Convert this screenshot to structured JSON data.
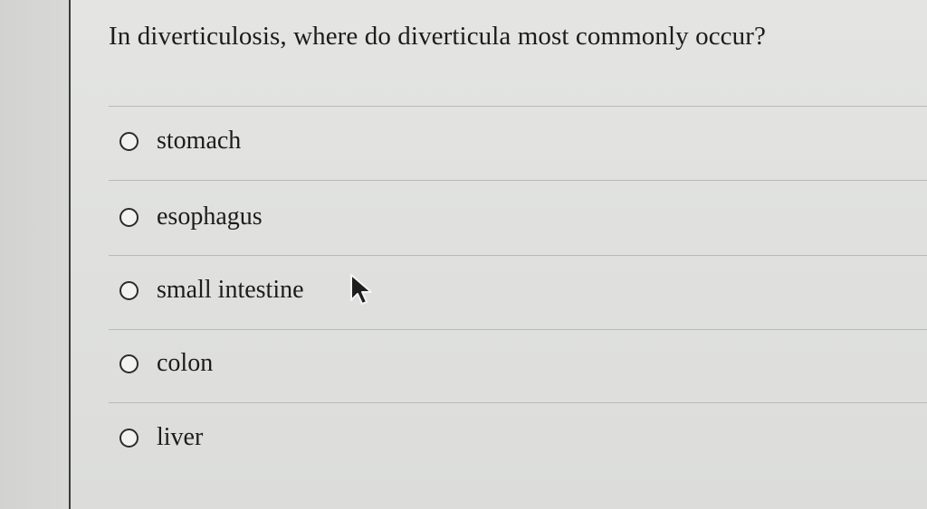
{
  "question": {
    "text": "In diverticulosis, where do diverticula most commonly occur?"
  },
  "options": [
    {
      "label": "stomach",
      "selected": false
    },
    {
      "label": "esophagus",
      "selected": false
    },
    {
      "label": "small intestine",
      "selected": false
    },
    {
      "label": "colon",
      "selected": false
    },
    {
      "label": "liver",
      "selected": false
    }
  ],
  "pointer": {
    "icon": "mouse-pointer-icon"
  }
}
